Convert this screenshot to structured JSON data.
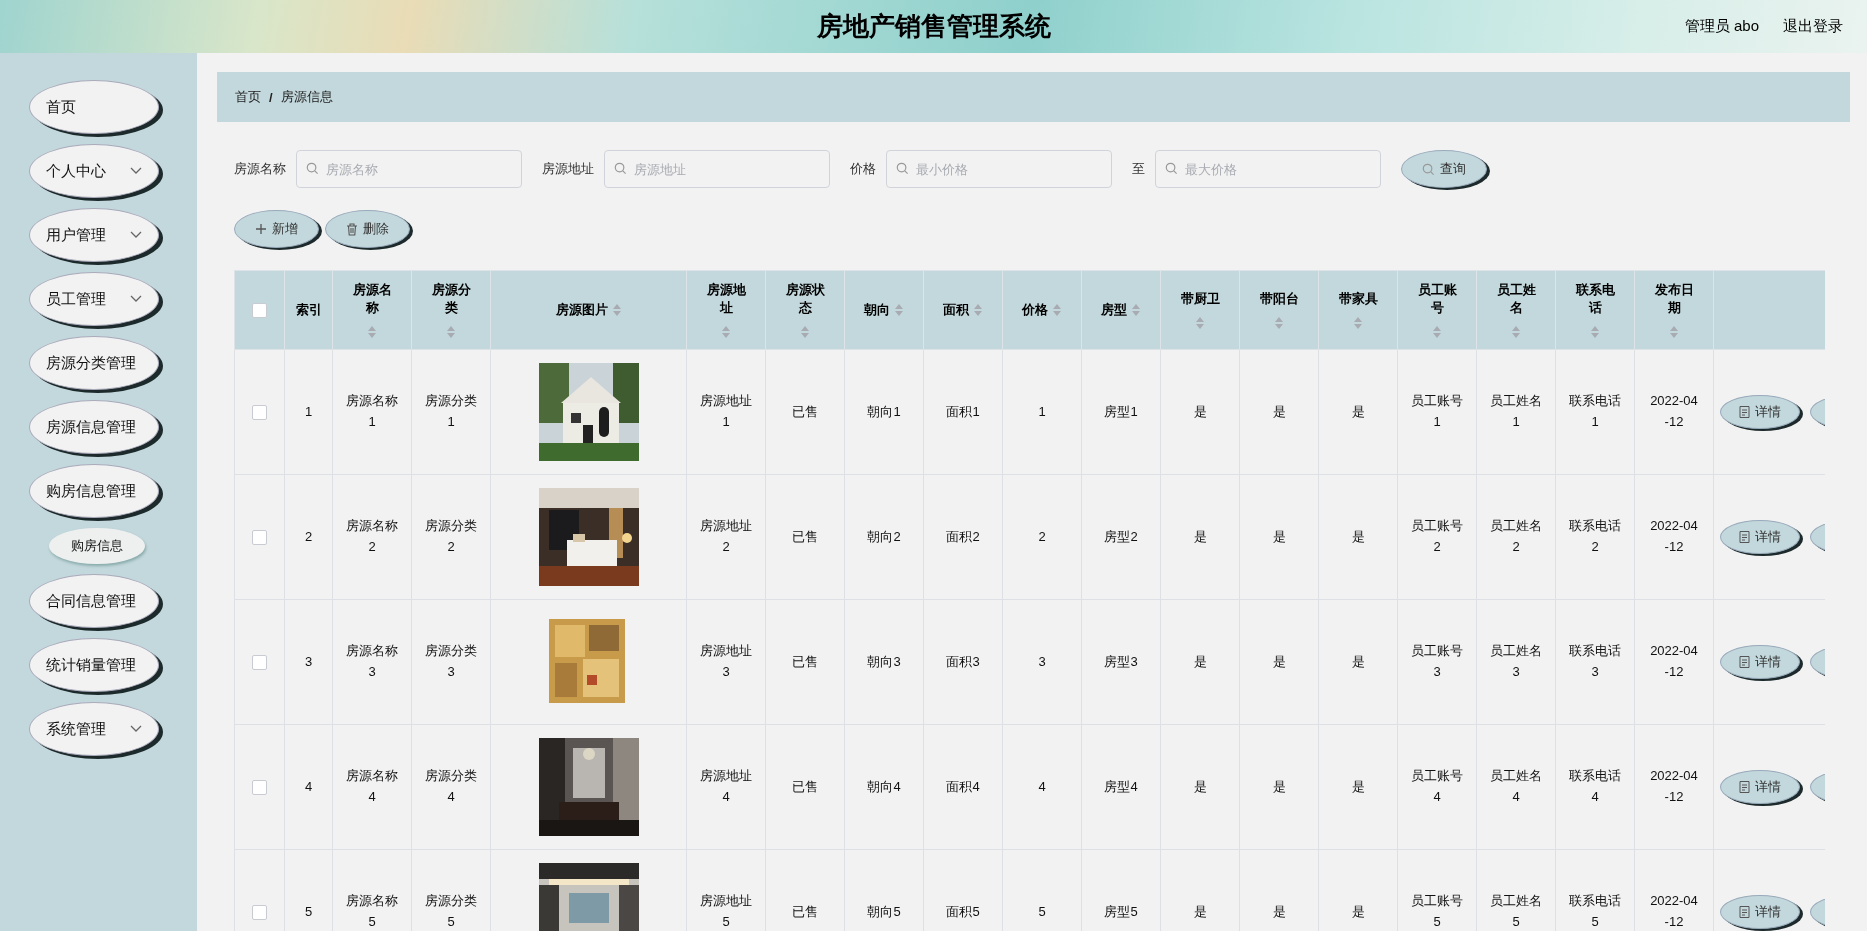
{
  "header": {
    "title": "房地产销售管理系统",
    "user": "管理员 abo",
    "logout": "退出登录"
  },
  "sidebar": {
    "items": [
      {
        "label": "首页",
        "selected": false
      },
      {
        "label": "个人中心",
        "selected": false,
        "expanded": false
      },
      {
        "label": "用户管理",
        "selected": false,
        "expanded": false
      },
      {
        "label": "员工管理",
        "selected": false,
        "expanded": false
      },
      {
        "label": "房源分类管理",
        "selected": false
      },
      {
        "label": "房源信息管理",
        "selected": false
      },
      {
        "label": "购房信息管理",
        "selected": false,
        "expanded": true,
        "children": [
          {
            "label": "购房信息",
            "selected": false
          }
        ]
      },
      {
        "label": "合同信息管理",
        "selected": false
      },
      {
        "label": "统计销量管理",
        "selected": false
      },
      {
        "label": "系统管理",
        "selected": false,
        "expanded": false
      }
    ]
  },
  "breadcrumb": [
    "首页",
    "/",
    "房源信息"
  ],
  "search": {
    "fields": [
      {
        "label": "房源名称",
        "placeholder": "房源名称"
      },
      {
        "label": "房源地址",
        "placeholder": "房源地址"
      },
      {
        "label": "价格",
        "placeholder": "最小价格"
      },
      {
        "label": "至",
        "placeholder": "最大价格"
      }
    ],
    "button": "查询"
  },
  "toolbar": [
    {
      "kind": "add",
      "label": "新增"
    },
    {
      "kind": "delete",
      "label": "删除"
    }
  ],
  "table": {
    "header_checked": false,
    "columns": [
      {
        "label": "索引",
        "kind": "index",
        "sortable": false
      },
      {
        "label": "房源名称",
        "kind": "text",
        "sortable": true
      },
      {
        "label": "房源分类",
        "kind": "text",
        "sortable": true
      },
      {
        "label": "房源图片",
        "kind": "picture",
        "sortable": true
      },
      {
        "label": "房源地址",
        "kind": "text",
        "sortable": true
      },
      {
        "label": "房源状态",
        "kind": "text",
        "sortable": true
      },
      {
        "label": "朝向",
        "kind": "text",
        "sortable": true
      },
      {
        "label": "面积",
        "kind": "text",
        "sortable": true
      },
      {
        "label": "价格",
        "kind": "text",
        "sortable": true
      },
      {
        "label": "房型",
        "kind": "text",
        "sortable": true
      },
      {
        "label": "带厨卫",
        "kind": "text",
        "sortable": true
      },
      {
        "label": "带阳台",
        "kind": "text",
        "sortable": true
      },
      {
        "label": "带家具",
        "kind": "text",
        "sortable": true
      },
      {
        "label": "员工账号",
        "kind": "text",
        "sortable": true
      },
      {
        "label": "员工姓名",
        "kind": "text",
        "sortable": true
      },
      {
        "label": "联系电话",
        "kind": "text",
        "sortable": true
      },
      {
        "label": "发布日期",
        "kind": "date",
        "sortable": true
      }
    ],
    "rows": [
      {
        "checked": false,
        "cells": [
          "1",
          "房源名称1",
          "房源分类1",
          {
            "kind": "picture"
          },
          "房源地址1",
          "已售",
          "朝向1",
          "面积1",
          "1",
          "房型1",
          "是",
          "是",
          "是",
          "员工账号1",
          "员工姓名1",
          "联系电话1",
          "2022-04-12"
        ],
        "actions": [
          {
            "kind": "detail",
            "label": "详情"
          },
          {
            "kind": "hidden"
          }
        ]
      },
      {
        "checked": false,
        "cells": [
          "2",
          "房源名称2",
          "房源分类2",
          {
            "kind": "picture"
          },
          "房源地址2",
          "已售",
          "朝向2",
          "面积2",
          "2",
          "房型2",
          "是",
          "是",
          "是",
          "员工账号2",
          "员工姓名2",
          "联系电话2",
          "2022-04-12"
        ],
        "actions": [
          {
            "kind": "detail",
            "label": "详情"
          },
          {
            "kind": "hidden"
          }
        ]
      },
      {
        "checked": false,
        "cells": [
          "3",
          "房源名称3",
          "房源分类3",
          {
            "kind": "picture"
          },
          "房源地址3",
          "已售",
          "朝向3",
          "面积3",
          "3",
          "房型3",
          "是",
          "是",
          "是",
          "员工账号3",
          "员工姓名3",
          "联系电话3",
          "2022-04-12"
        ],
        "actions": [
          {
            "kind": "detail",
            "label": "详情"
          },
          {
            "kind": "hidden"
          }
        ]
      },
      {
        "checked": false,
        "cells": [
          "4",
          "房源名称4",
          "房源分类4",
          {
            "kind": "picture"
          },
          "房源地址4",
          "已售",
          "朝向4",
          "面积4",
          "4",
          "房型4",
          "是",
          "是",
          "是",
          "员工账号4",
          "员工姓名4",
          "联系电话4",
          "2022-04-12"
        ],
        "actions": [
          {
            "kind": "detail",
            "label": "详情"
          },
          {
            "kind": "hidden"
          }
        ]
      },
      {
        "checked": false,
        "cells": [
          "5",
          "房源名称5",
          "房源分类5",
          {
            "kind": "picture"
          },
          "房源地址5",
          "已售",
          "朝向5",
          "面积5",
          "5",
          "房型5",
          "是",
          "是",
          "是",
          "员工账号5",
          "员工姓名5",
          "联系电话5",
          "2022-04-12"
        ],
        "actions": [
          {
            "kind": "detail",
            "label": "详情"
          },
          {
            "kind": "hidden"
          }
        ]
      }
    ]
  }
}
